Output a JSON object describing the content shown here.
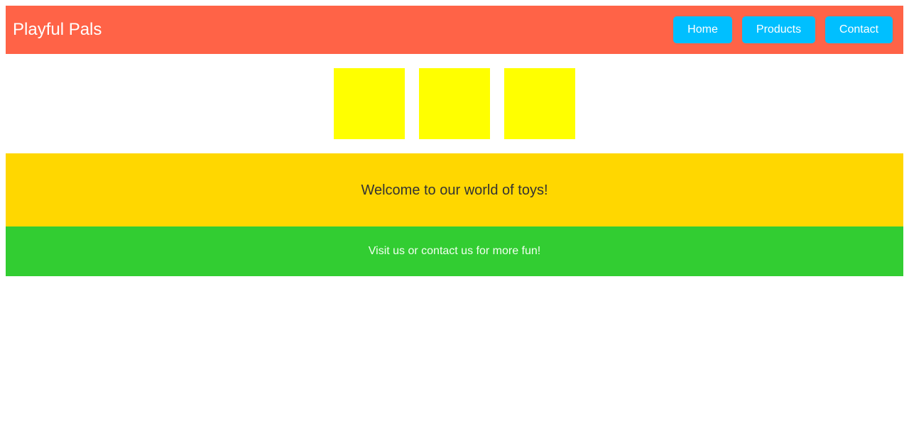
{
  "header": {
    "brand": "Playful Pals",
    "nav": {
      "home": "Home",
      "products": "Products",
      "contact": "Contact"
    }
  },
  "gallery": {
    "items": [
      {
        "name": "toy-block-1"
      },
      {
        "name": "toy-block-2"
      },
      {
        "name": "toy-block-3"
      }
    ]
  },
  "welcome": {
    "text": "Welcome to our world of toys!"
  },
  "footer": {
    "text": "Visit us or contact us for more fun!"
  },
  "colors": {
    "header_bg": "#ff6347",
    "button_bg": "#00bfff",
    "toy_block": "#ffff00",
    "welcome_bg": "#ffd700",
    "footer_bg": "#32cd32"
  }
}
